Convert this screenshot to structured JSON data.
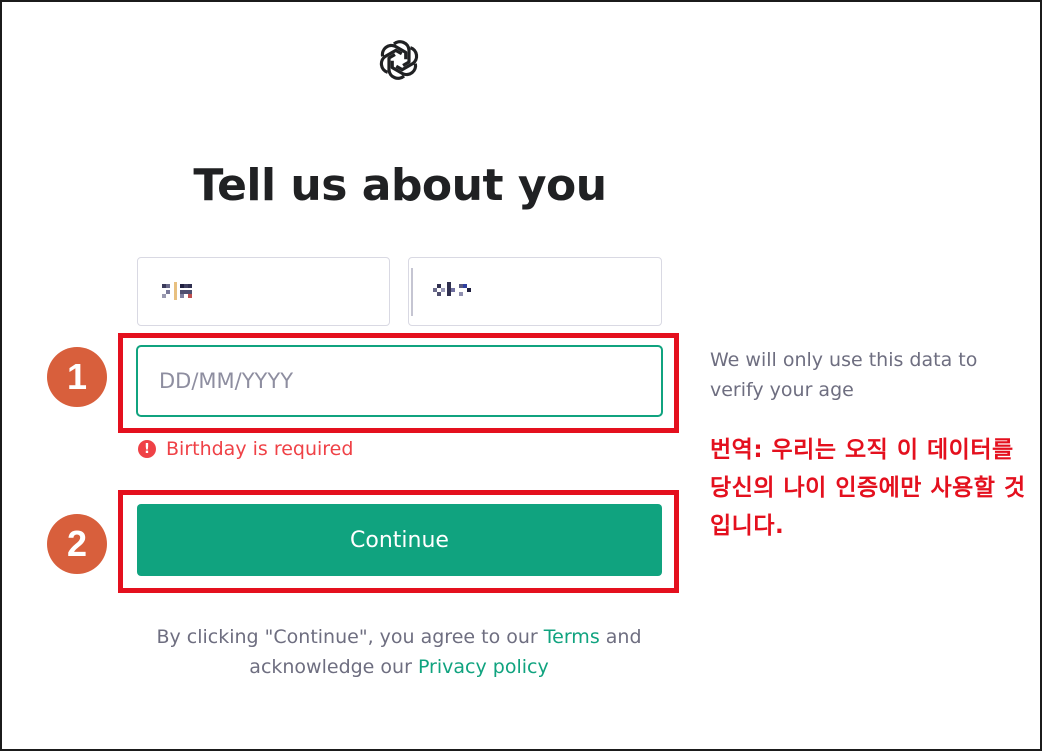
{
  "page": {
    "logo_icon": "openai-logo-icon",
    "title": "Tell us about you"
  },
  "form": {
    "first_name_value": "",
    "last_name_value": "",
    "birthday_placeholder": "DD/MM/YYYY",
    "birthday_value": "",
    "error_icon": "exclamation-circle-icon",
    "error_text": "Birthday is required",
    "continue_label": "Continue"
  },
  "side_note": "We will only use this data to verify your age",
  "annotations": {
    "badge_1": "1",
    "badge_2": "2",
    "translation": "번역: 우리는 오직 이 데이터를 당신의 나이 인증에만 사용할 것입니다."
  },
  "legal": {
    "prefix": "By clicking \"Continue\", you agree to our ",
    "terms_link": "Terms",
    "middle": " and acknowledge our ",
    "privacy_link": "Privacy policy"
  },
  "colors": {
    "brand_green": "#10a37f",
    "error_red": "#ef4146",
    "annotation_red": "#e4101e",
    "badge_orange": "#d85f3c"
  }
}
